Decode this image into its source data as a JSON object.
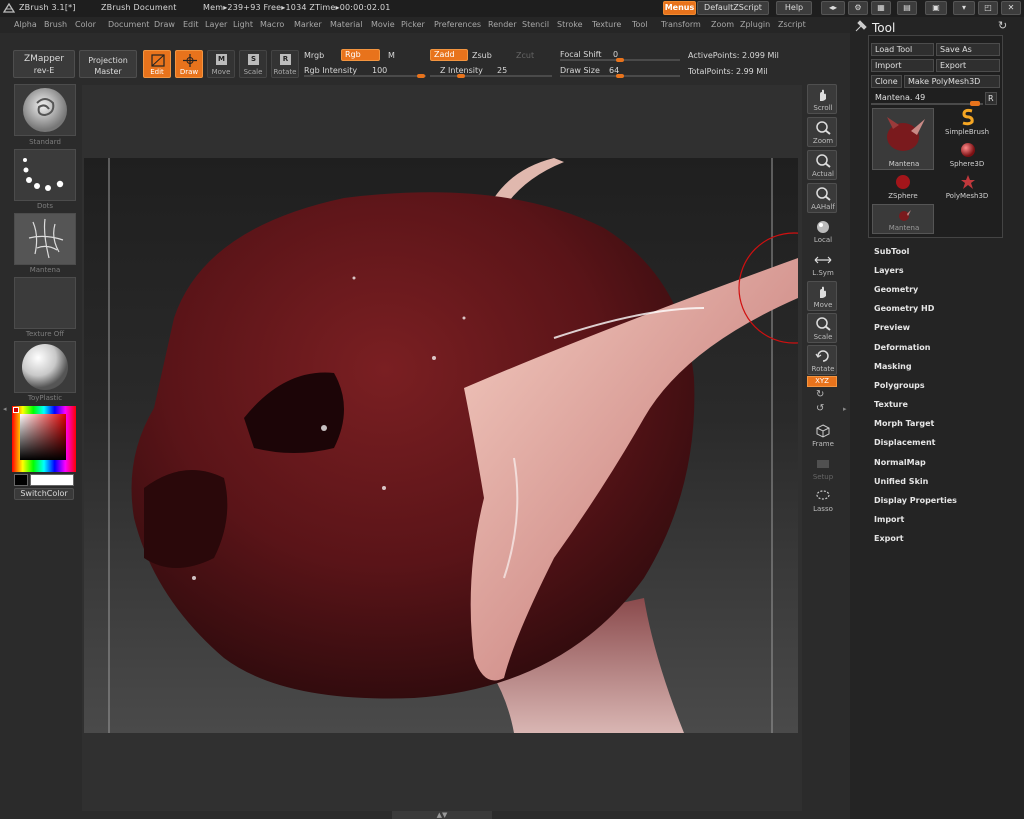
{
  "titlebar": {
    "app": "ZBrush  3.1[*]",
    "doc": "ZBrush Document",
    "mem": "Mem▸239+93 Free▸1034 ZTime▸00:00:02.01",
    "menus_btn": "Menus",
    "script_btn": "DefaultZScript",
    "help_btn": "Help"
  },
  "menubar": [
    "Alpha",
    "Brush",
    "Color",
    "Document",
    "Draw",
    "Edit",
    "Layer",
    "Light",
    "Macro",
    "Marker",
    "Material",
    "Movie",
    "Picker",
    "Preferences",
    "Render",
    "Stencil",
    "Stroke",
    "Texture",
    "Tool",
    "Transform",
    "Zoom",
    "Zplugin",
    "Zscript"
  ],
  "shelf": {
    "zmapper": "ZMapper",
    "zmapper_sub": "rev-E",
    "projection": "Projection",
    "projection_sub": "Master",
    "edit": "Edit",
    "draw": "Draw",
    "move": "Move",
    "scale": "Scale",
    "rotate": "Rotate",
    "mrgb": "Mrgb",
    "rgb": "Rgb",
    "m": "M",
    "rgb_intensity_label": "Rgb Intensity",
    "rgb_intensity_value": "100",
    "zadd": "Zadd",
    "zsub": "Zsub",
    "zcut": "Zcut",
    "z_intensity_label": "Z Intensity",
    "z_intensity_value": "25",
    "focal_label": "Focal Shift",
    "focal_value": "0",
    "draw_size_label": "Draw Size",
    "draw_size_value": "64",
    "active_points": "ActivePoints: 2.099 Mil",
    "total_points": "TotalPoints: 2.99 Mil"
  },
  "left": {
    "brush": "Standard",
    "stroke": "Dots",
    "alpha": "Mantena",
    "texture": "Texture Off",
    "material": "ToyPlastic",
    "switch_color": "SwitchColor"
  },
  "right_tools": [
    "Scroll",
    "Zoom",
    "Actual",
    "AAHalf",
    "Local",
    "L.Sym",
    "Move",
    "Scale",
    "Rotate",
    "XYZ",
    "Frame",
    "Setup",
    "Lasso"
  ],
  "tool_panel": {
    "title": "Tool",
    "load_tool": "Load Tool",
    "save_as": "Save As",
    "import": "Import",
    "export": "Export",
    "clone": "Clone",
    "make_polymesh": "Make PolyMesh3D",
    "mesh_name": "Mantena. 49",
    "r_btn": "R",
    "tiles": [
      "Mantena",
      "SimpleBrush",
      "Sphere3D",
      "ZSphere",
      "PolyMesh3D",
      "Mantena"
    ],
    "subpalettes": [
      "SubTool",
      "Layers",
      "Geometry",
      "Geometry HD",
      "Preview",
      "Deformation",
      "Masking",
      "Polygroups",
      "Texture",
      "Morph Target",
      "Displacement",
      "NormalMap",
      "Unified Skin",
      "Display Properties",
      "Import",
      "Export"
    ]
  }
}
